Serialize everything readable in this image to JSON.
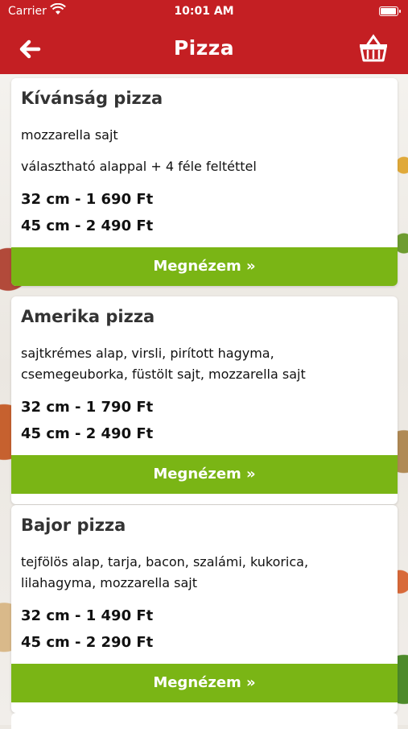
{
  "status_bar": {
    "carrier": "Carrier",
    "time": "10:01 AM"
  },
  "nav": {
    "title": "Pizza"
  },
  "pizzas": [
    {
      "name": "Kívánság pizza",
      "desc_lines": [
        "mozzarella  sajt",
        "választható alappal + 4 féle feltéttel"
      ],
      "price_small": "32 cm - 1 690 Ft",
      "price_large": "45 cm - 2 490 Ft",
      "button": "Megnézem »"
    },
    {
      "name": "Amerika pizza",
      "desc_lines": [
        "sajtkrémes alap, virsli, pirított hagyma,",
        "csemegeuborka, füstölt sajt, mozzarella  sajt"
      ],
      "price_small": "32 cm - 1 790 Ft",
      "price_large": "45 cm - 2 490 Ft",
      "button": "Megnézem »"
    },
    {
      "name": "Bajor pizza",
      "desc_lines": [
        "tejfölös alap, tarja, bacon, szalámi, kukorica,",
        "lilahagyma, mozzarella  sajt"
      ],
      "price_small": "32 cm - 1 490 Ft",
      "price_large": "45 cm - 2 290 Ft",
      "button": "Megnézem »"
    }
  ],
  "colors": {
    "brand_red": "#c41f23",
    "button_green": "#7ab515"
  },
  "icons": {
    "back": "arrow-left-icon",
    "cart": "basket-icon",
    "wifi": "wifi-icon",
    "battery": "battery-icon"
  }
}
